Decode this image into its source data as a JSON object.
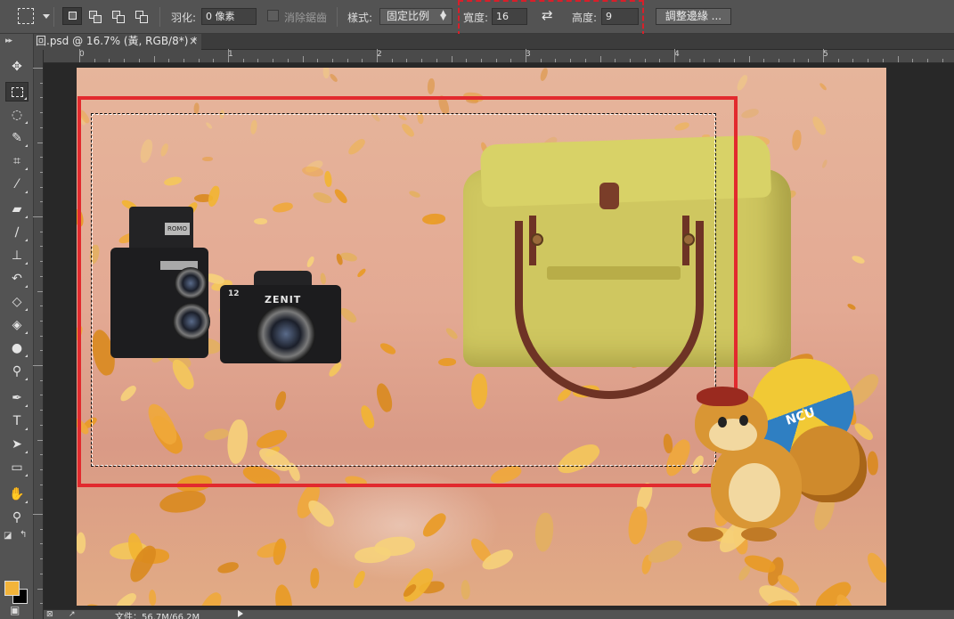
{
  "options_bar": {
    "feather_label": "羽化:",
    "feather_value": "0 像素",
    "antialias_label": "消除鋸齒",
    "style_label": "樣式:",
    "style_value": "固定比例",
    "width_label": "寬度:",
    "width_value": "16",
    "height_label": "高度:",
    "height_value": "9",
    "refine_edge_label": "調整邊緣 ..."
  },
  "document_tab": {
    "title": "回.psd @ 16.7% (黃, RGB/8*) *",
    "close_glyph": "×"
  },
  "ruler": {
    "labels": [
      "0",
      "1",
      "2",
      "3",
      "4",
      "5"
    ]
  },
  "camera_text": {
    "brand_badge": "ROMO",
    "model_name": "ZENIT",
    "model_number": "12"
  },
  "mascot": {
    "umbrella_text": "NCU"
  },
  "status_bar": {
    "file_info": "文件：56.7M/66.2M"
  },
  "colors": {
    "foreground": "#f3b43a",
    "background": "#000000",
    "highlight": "#d81f2a",
    "annotation_rect": "#e22a2e"
  },
  "tools": [
    "move-icon",
    "rectangular-marquee-icon",
    "lasso-icon",
    "quick-selection-icon",
    "crop-icon",
    "eyedropper-icon",
    "spot-healing-icon",
    "brush-icon",
    "clone-stamp-icon",
    "history-brush-icon",
    "eraser-icon",
    "paint-bucket-icon",
    "blur-icon",
    "dodge-icon",
    "pen-icon",
    "type-icon",
    "path-selection-icon",
    "rectangle-shape-icon",
    "hand-icon",
    "zoom-icon"
  ]
}
